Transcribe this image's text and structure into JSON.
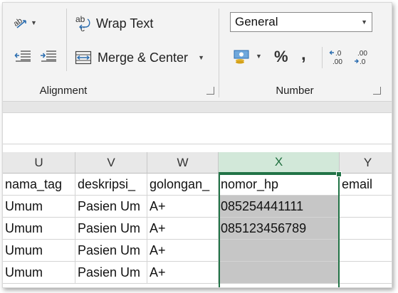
{
  "ribbon": {
    "alignment": {
      "wrap_text_label": "Wrap Text",
      "merge_center_label": "Merge & Center",
      "group_label": "Alignment"
    },
    "number": {
      "format_value": "General",
      "percent_glyph": "%",
      "comma_glyph": ",",
      "group_label": "Number"
    }
  },
  "columns": [
    {
      "letter": "U",
      "selected": false
    },
    {
      "letter": "V",
      "selected": false
    },
    {
      "letter": "W",
      "selected": false
    },
    {
      "letter": "X",
      "selected": true
    },
    {
      "letter": "Y",
      "selected": false
    }
  ],
  "rows": [
    [
      "nama_tag",
      "deskripsi_",
      "golongan_",
      "nomor_hp",
      "email"
    ],
    [
      "Umum",
      "Pasien Um",
      "A+",
      "085254441111",
      ""
    ],
    [
      "Umum",
      "Pasien Um",
      "A+",
      "085123456789",
      ""
    ],
    [
      "Umum",
      "Pasien Um",
      "A+",
      "",
      ""
    ],
    [
      "Umum",
      "Pasien Um",
      "A+",
      "",
      ""
    ]
  ],
  "colors": {
    "accent": "#217346",
    "selected_header_bg": "#d2e8d9",
    "selected_cells_bg": "#c6c6c6",
    "ribbon_bg": "#f3f3f3"
  }
}
